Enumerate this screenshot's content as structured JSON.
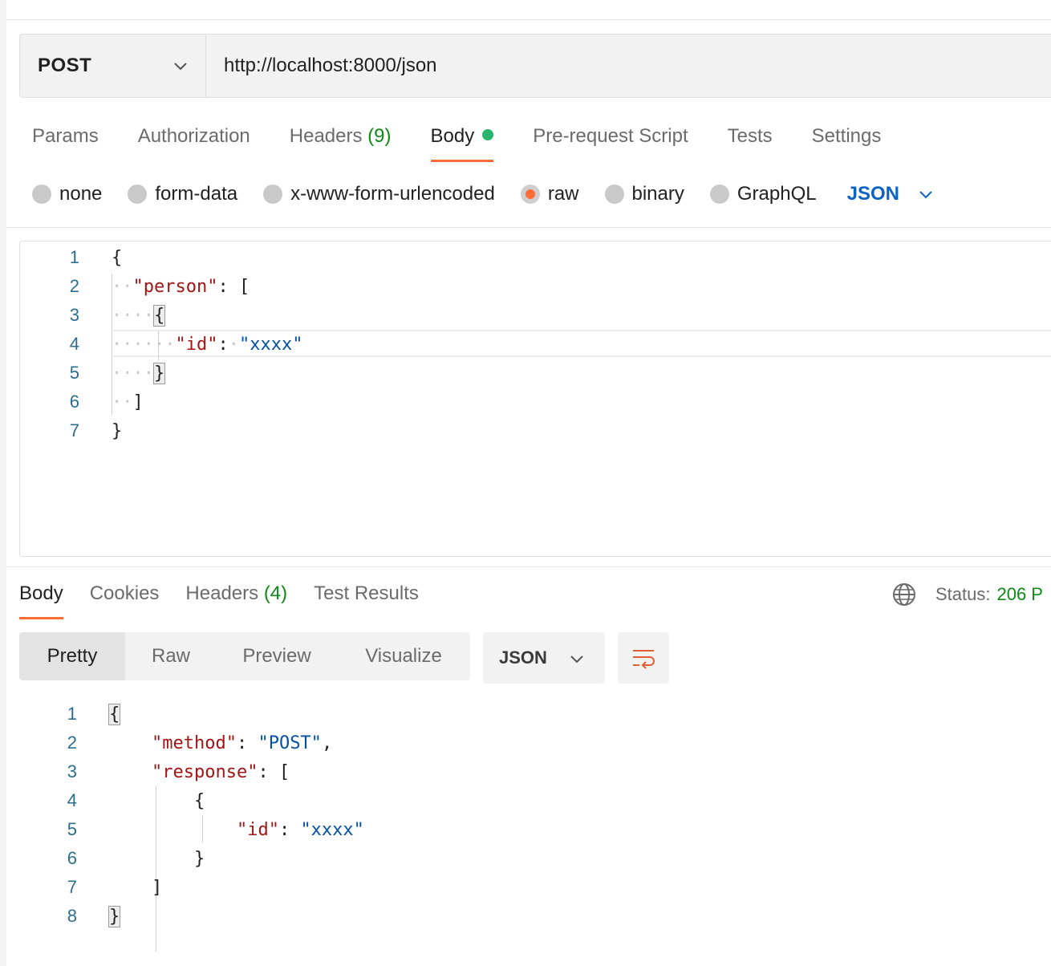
{
  "request": {
    "method": "POST",
    "url": "http://localhost:8000/json",
    "tabs": [
      {
        "label": "Params"
      },
      {
        "label": "Authorization"
      },
      {
        "label": "Headers",
        "count": "(9)"
      },
      {
        "label": "Body"
      },
      {
        "label": "Pre-request Script"
      },
      {
        "label": "Tests"
      },
      {
        "label": "Settings"
      }
    ],
    "active_tab": "Body",
    "body_types": [
      "none",
      "form-data",
      "x-www-form-urlencoded",
      "raw",
      "binary",
      "GraphQL"
    ],
    "selected_body_type": "raw",
    "language": "JSON",
    "line_numbers": [
      "1",
      "2",
      "3",
      "4",
      "5",
      "6",
      "7"
    ],
    "code": {
      "l1": "{",
      "l2_key": "\"person\"",
      "l2_rest": ": [",
      "l3": "{",
      "l4_key": "\"id\"",
      "l4_sep": ":",
      "l4_val": "\"xxxx\"",
      "l5": "}",
      "l6": "]",
      "l7": "}"
    }
  },
  "response": {
    "tabs": [
      {
        "label": "Body"
      },
      {
        "label": "Cookies"
      },
      {
        "label": "Headers",
        "count": "(4)"
      },
      {
        "label": "Test Results"
      }
    ],
    "active_tab": "Body",
    "status_label": "Status:",
    "status_value": "206 P",
    "views": [
      "Pretty",
      "Raw",
      "Preview",
      "Visualize"
    ],
    "active_view": "Pretty",
    "format": "JSON",
    "line_numbers": [
      "1",
      "2",
      "3",
      "4",
      "5",
      "6",
      "7",
      "8"
    ],
    "code": {
      "l1": "{",
      "l2_key": "\"method\"",
      "l2_sep": ": ",
      "l2_val": "\"POST\"",
      "l2_end": ",",
      "l3_key": "\"response\"",
      "l3_rest": ": [",
      "l4": "{",
      "l5_key": "\"id\"",
      "l5_sep": ": ",
      "l5_val": "\"xxxx\"",
      "l6": "}",
      "l7": "]",
      "l8": "}"
    }
  },
  "colors": {
    "accent": "#ff6c37",
    "success": "#0e8a16",
    "link": "#0b63c4",
    "json_key": "#a31515",
    "json_string": "#0451a5"
  },
  "icons": [
    "chevron-down-icon",
    "globe-icon",
    "wrap-lines-icon"
  ]
}
